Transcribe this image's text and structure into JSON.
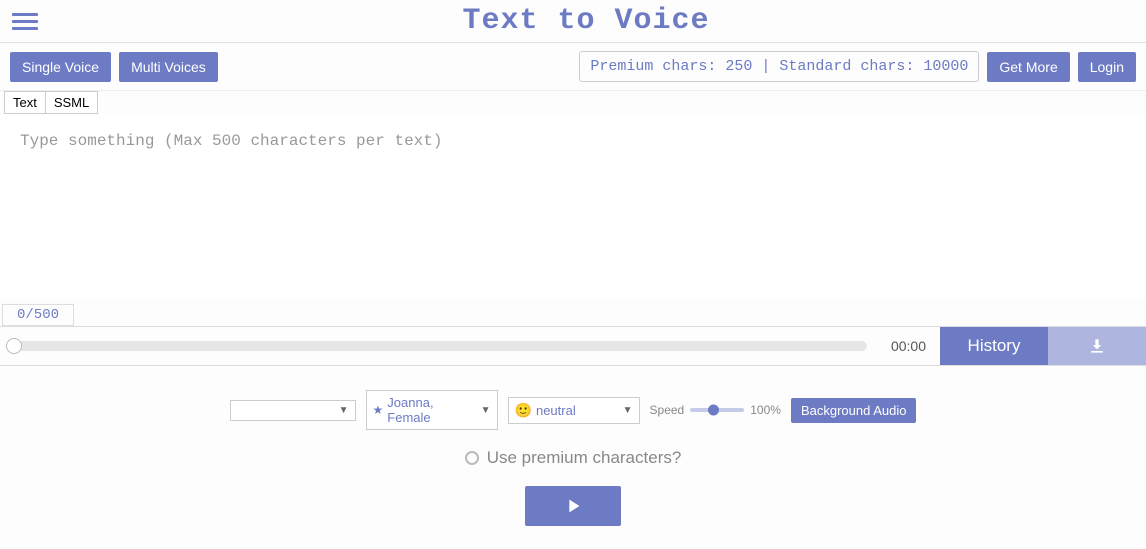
{
  "header": {
    "title": "Text to Voice"
  },
  "toolbar": {
    "single_voice": "Single Voice",
    "multi_voices": "Multi Voices",
    "char_info": "Premium chars: 250 | Standard chars: 10000",
    "get_more": "Get More",
    "login": "Login"
  },
  "tabs": {
    "text": "Text",
    "ssml": "SSML"
  },
  "editor": {
    "placeholder": "Type something (Max 500 characters per text)",
    "value": "",
    "counter": "0/500"
  },
  "player": {
    "time": "00:00",
    "history": "History"
  },
  "controls": {
    "language": "",
    "voice": "Joanna, Female",
    "emotion": "neutral",
    "speed_label": "Speed",
    "speed_value": "100%",
    "bg_audio": "Background Audio"
  },
  "premium": {
    "label": "Use premium characters?"
  }
}
